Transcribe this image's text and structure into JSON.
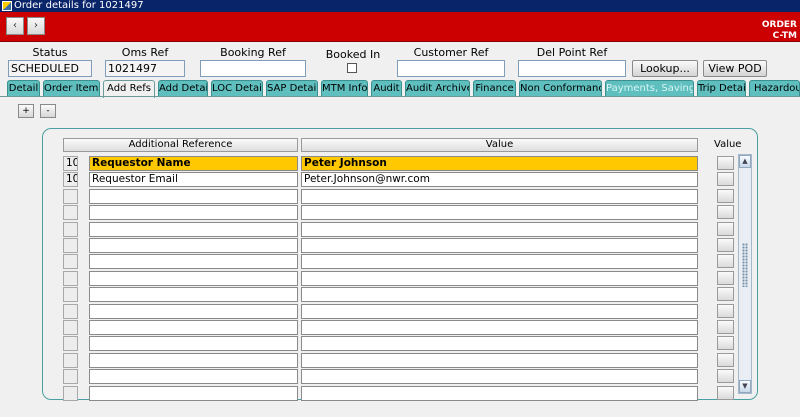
{
  "window": {
    "title": "Order details for 1021497"
  },
  "header_band": {
    "line1": "ORDER",
    "line2": "C-TM"
  },
  "nav": {
    "prev": "‹",
    "next": "›"
  },
  "fields": {
    "status": {
      "label": "Status",
      "value": "SCHEDULED"
    },
    "oms_ref": {
      "label": "Oms Ref",
      "value": "1021497"
    },
    "booking_ref": {
      "label": "Booking Ref",
      "value": ""
    },
    "booked_in": {
      "label": "Booked In"
    },
    "customer_ref": {
      "label": "Customer Ref",
      "value": ""
    },
    "del_point_ref": {
      "label": "Del Point Ref",
      "value": ""
    }
  },
  "buttons": {
    "lookup": "Lookup...",
    "view_pod": "View POD"
  },
  "tabs": [
    "Detail",
    "Order Items",
    "Add Refs",
    "Add Detail",
    "LOC Detail",
    "SAP Detail",
    "MTM Info",
    "Audit",
    "Audit Archive",
    "Finance",
    "Non Conformance",
    "Payments, Savings",
    "Trip Detail",
    "Hazardous"
  ],
  "active_tab": "Add Refs",
  "toolbar": {
    "add": "+",
    "remove": "-"
  },
  "grid": {
    "columns": {
      "reference": "Additional Reference",
      "value": "Value",
      "side": "Value"
    },
    "rows": [
      {
        "idx": "10",
        "reference": "Requestor Name",
        "value": "Peter Johnson"
      },
      {
        "idx": "10",
        "reference": "Requestor Email",
        "value": "Peter.Johnson@nwr.com"
      },
      {
        "idx": "",
        "reference": "",
        "value": ""
      },
      {
        "idx": "",
        "reference": "",
        "value": ""
      },
      {
        "idx": "",
        "reference": "",
        "value": ""
      },
      {
        "idx": "",
        "reference": "",
        "value": ""
      },
      {
        "idx": "",
        "reference": "",
        "value": ""
      },
      {
        "idx": "",
        "reference": "",
        "value": ""
      },
      {
        "idx": "",
        "reference": "",
        "value": ""
      },
      {
        "idx": "",
        "reference": "",
        "value": ""
      },
      {
        "idx": "",
        "reference": "",
        "value": ""
      },
      {
        "idx": "",
        "reference": "",
        "value": ""
      },
      {
        "idx": "",
        "reference": "",
        "value": ""
      },
      {
        "idx": "",
        "reference": "",
        "value": ""
      },
      {
        "idx": "",
        "reference": "",
        "value": ""
      }
    ],
    "selected_row": 0
  },
  "colors": {
    "band": "#cc0000",
    "tab": "#5fbfbf",
    "selection": "#ffc800",
    "panel_border": "#4aa0a0"
  }
}
